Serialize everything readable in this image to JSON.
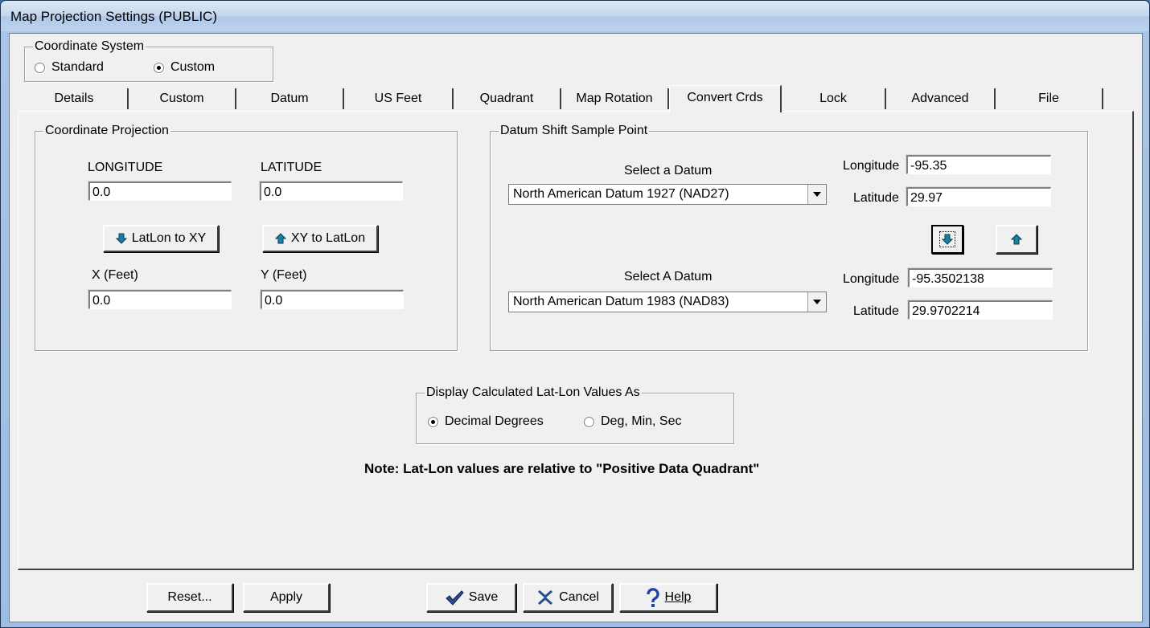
{
  "window": {
    "title": "Map Projection Settings (PUBLIC)"
  },
  "coordinate_system": {
    "title": "Coordinate System",
    "options": [
      "Standard",
      "Custom"
    ],
    "selected": "Custom"
  },
  "tabs": [
    "Details",
    "Custom",
    "Datum",
    "US Feet",
    "Quadrant",
    "Map Rotation",
    "Convert Crds",
    "Lock",
    "Advanced",
    "File"
  ],
  "active_tab": "Convert Crds",
  "coordinate_projection": {
    "title": "Coordinate Projection",
    "longitude_label": "LONGITUDE",
    "latitude_label": "LATITUDE",
    "longitude_value": "0.0",
    "latitude_value": "0.0",
    "latlon_to_xy_label": "LatLon to XY",
    "xy_to_latlon_label": "XY to LatLon",
    "x_label": "X (Feet)",
    "y_label": "Y (Feet)",
    "x_value": "0.0",
    "y_value": "0.0"
  },
  "datum_shift": {
    "title": "Datum Shift Sample Point",
    "select1_label": "Select a Datum",
    "select1_value": "North American Datum 1927 (NAD27)",
    "lon1_label": "Longitude",
    "lon1_value": "-95.35",
    "lat1_label": "Latitude",
    "lat1_value": "29.97",
    "select2_label": "Select A Datum",
    "select2_value": "North American Datum 1983 (NAD83)",
    "lon2_label": "Longitude",
    "lon2_value": "-95.3502138",
    "lat2_label": "Latitude",
    "lat2_value": "29.9702214"
  },
  "display_latlon": {
    "title": "Display Calculated Lat-Lon Values As",
    "options": [
      "Decimal Degrees",
      "Deg, Min, Sec"
    ],
    "selected": "Decimal Degrees"
  },
  "note": "Note: Lat-Lon values are relative to \"Positive Data Quadrant\"",
  "footer": {
    "reset": "Reset...",
    "apply": "Apply",
    "save": "Save",
    "cancel": "Cancel",
    "help": "Help"
  },
  "colors": {
    "arrow_icon": "#1a7fa0",
    "save_check": "#2a4f8f",
    "cancel_x": "#2a4f8f",
    "help_q": "#2244aa"
  },
  "icons": [
    "arrow-down-icon",
    "arrow-up-icon",
    "checkmark-icon",
    "cancel-x-icon",
    "question-mark-icon"
  ]
}
